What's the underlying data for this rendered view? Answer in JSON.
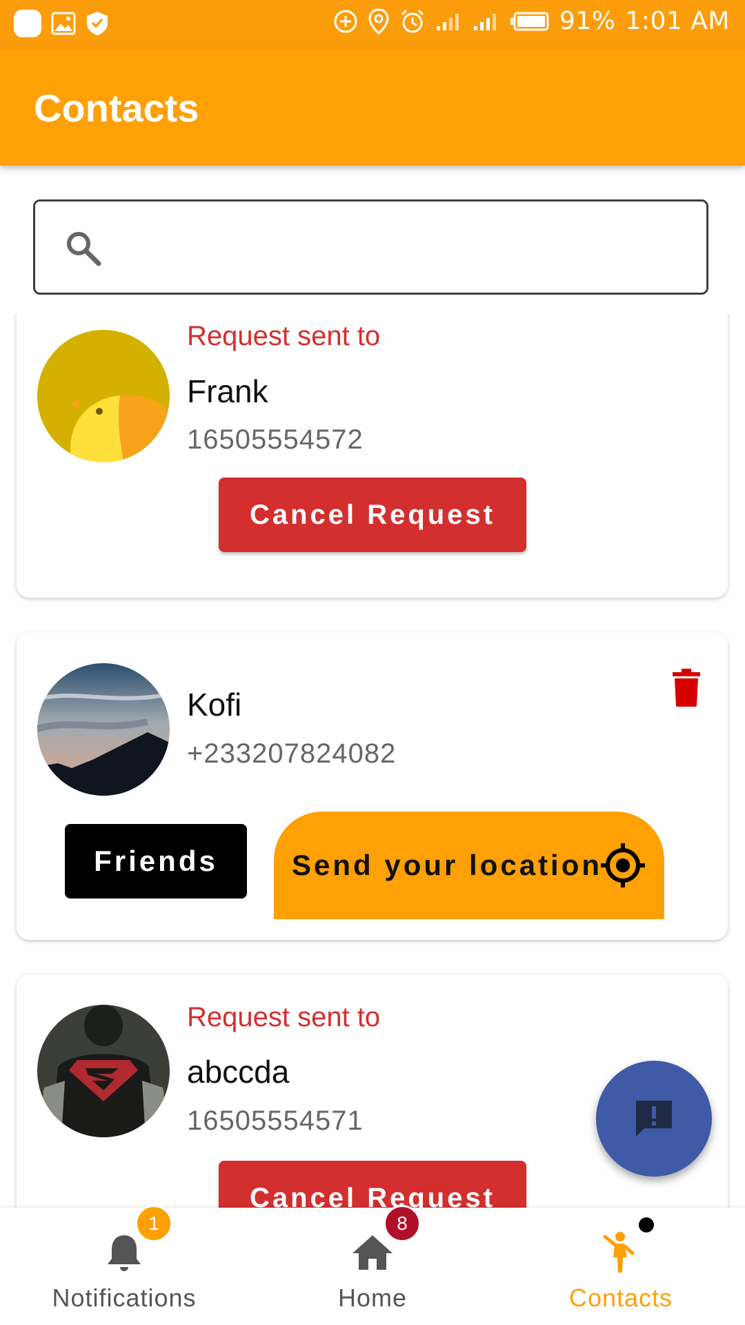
{
  "status_bar": {
    "battery": "91%",
    "time": "1:01 AM"
  },
  "app_bar": {
    "title": "Contacts"
  },
  "search": {
    "placeholder": "",
    "value": ""
  },
  "contacts": [
    {
      "status": "Request sent to",
      "name": "Frank",
      "phone": "16505554572",
      "action": "Cancel Request"
    },
    {
      "name": "Kofi",
      "phone": "+233207824082",
      "friends_label": "Friends",
      "location_label": "Send your location"
    },
    {
      "status": "Request sent to",
      "name": "abccda",
      "phone": "16505554571",
      "action": "Cancel Request"
    }
  ],
  "bottom_nav": {
    "items": [
      {
        "label": "Notifications",
        "badge": "1",
        "icon": "bell-icon"
      },
      {
        "label": "Home",
        "badge": "8",
        "icon": "home-icon"
      },
      {
        "label": "Contacts",
        "icon": "person-waving-icon",
        "active": true
      }
    ]
  },
  "colors": {
    "primary": "#FFA005",
    "danger": "#D32F2F",
    "fab": "#3F5AA6",
    "badge_orange": "#FFA005",
    "badge_red": "#B0102A"
  }
}
